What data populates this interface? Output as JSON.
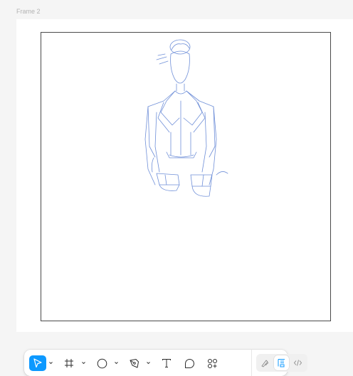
{
  "canvas": {
    "frame_label": "Frame 2"
  },
  "toolbar": {
    "tools": [
      {
        "icon": "move-icon",
        "active": true,
        "has_menu": true
      },
      {
        "icon": "frame-icon",
        "active": false,
        "has_menu": true
      },
      {
        "icon": "ellipse-icon",
        "active": false,
        "has_menu": true
      },
      {
        "icon": "pen-icon",
        "active": false,
        "has_menu": true
      },
      {
        "icon": "text-icon",
        "active": false,
        "has_menu": false
      },
      {
        "icon": "comment-icon",
        "active": false,
        "has_menu": false
      },
      {
        "icon": "actions-icon",
        "active": false,
        "has_menu": false
      }
    ],
    "modes": [
      {
        "icon": "draw-mode-icon",
        "selected": false
      },
      {
        "icon": "design-mode-icon",
        "selected": true
      },
      {
        "icon": "dev-mode-icon",
        "selected": false
      }
    ]
  },
  "colors": {
    "accent": "#0d99ff",
    "sketch_line": "#6f8fd8",
    "canvas_bg": "#f5f5f5"
  }
}
